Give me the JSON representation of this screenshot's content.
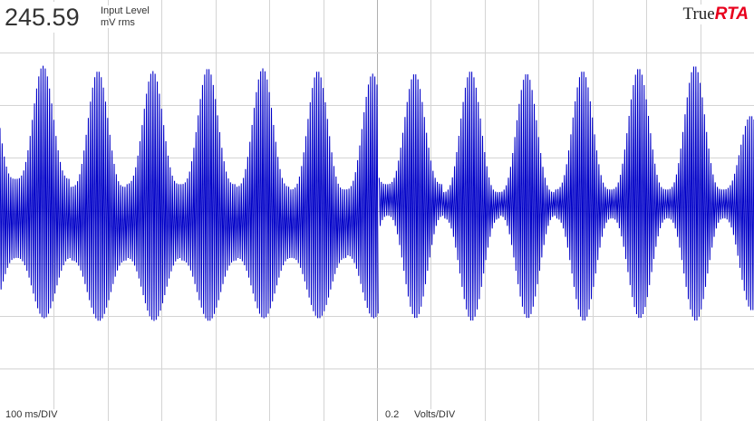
{
  "readout": {
    "value": "245.59",
    "label_line1": "Input Level",
    "label_line2": "mV rms"
  },
  "brand": {
    "part1": "True",
    "part2": "RTA",
    "accent_color": "#e8001c"
  },
  "scales": {
    "time": "100  ms/DIV",
    "volts_value": "0.2",
    "volts_unit": "Volts/DIV"
  },
  "colors": {
    "trace": "#0000c8",
    "grid": "#d4d4d4",
    "center_axis": "#b0b0b0"
  },
  "chart_data": {
    "type": "line",
    "description_kind": "oscilloscope waveform",
    "x_unit": "ms",
    "y_unit": "V",
    "x_range": [
      -700,
      700
    ],
    "y_range": [
      -0.8,
      0.8
    ],
    "grid": true,
    "envelope_peaks": {
      "left_half": {
        "x": [
          -620,
          -518,
          -416,
          -314,
          -212,
          -110,
          -8
        ],
        "peak_max": [
          0.55,
          0.53,
          0.53,
          0.54,
          0.54,
          0.53,
          0.52
        ],
        "peak_min": [
          -0.41,
          -0.42,
          -0.42,
          -0.42,
          -0.41,
          -0.41,
          -0.41
        ],
        "trough_max": [
          0.12,
          0.09,
          0.1,
          0.1,
          0.09,
          0.08,
          0.08
        ],
        "trough_min": [
          -0.18,
          -0.19,
          -0.18,
          -0.19,
          -0.18,
          -0.18,
          -0.17
        ]
      },
      "right_half": {
        "x": [
          70,
          174,
          278,
          382,
          486,
          590,
          694
        ],
        "peak_max": [
          0.52,
          0.53,
          0.52,
          0.53,
          0.54,
          0.55,
          0.36
        ],
        "peak_min": [
          -0.41,
          -0.42,
          -0.41,
          -0.42,
          -0.41,
          -0.42,
          -0.38
        ],
        "trough_max": [
          0.1,
          0.07,
          0.07,
          0.08,
          0.08,
          0.08,
          0.08
        ],
        "trough_min": [
          -0.02,
          -0.03,
          -0.02,
          -0.03,
          -0.03,
          -0.03,
          -0.03
        ]
      }
    },
    "carrier_period_ms": 4
  }
}
